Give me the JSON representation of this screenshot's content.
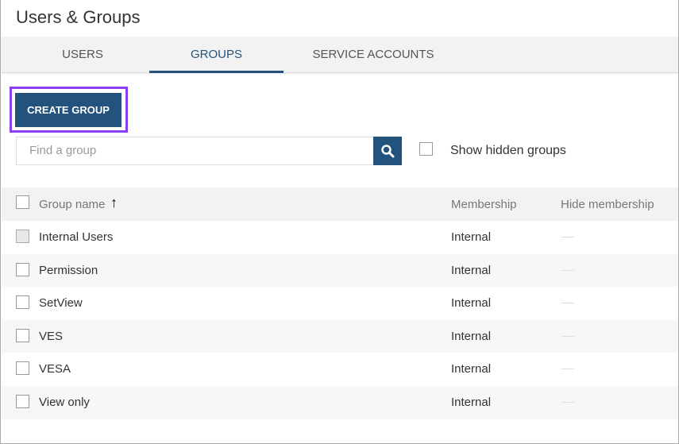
{
  "title": "Users & Groups",
  "tabs": [
    "USERS",
    "GROUPS",
    "SERVICE ACCOUNTS"
  ],
  "create_label": "CREATE GROUP",
  "search": {
    "placeholder": "Find a group"
  },
  "show_hidden_label": "Show hidden groups",
  "columns": {
    "name": "Group name",
    "sort": "↑",
    "membership": "Membership",
    "hide": "Hide membership"
  },
  "rows": [
    {
      "name": "Internal Users",
      "membership": "Internal"
    },
    {
      "name": "Permission",
      "membership": "Internal"
    },
    {
      "name": "SetView",
      "membership": "Internal"
    },
    {
      "name": "VES",
      "membership": "Internal"
    },
    {
      "name": "VESA",
      "membership": "Internal"
    },
    {
      "name": "View only",
      "membership": "Internal"
    }
  ]
}
